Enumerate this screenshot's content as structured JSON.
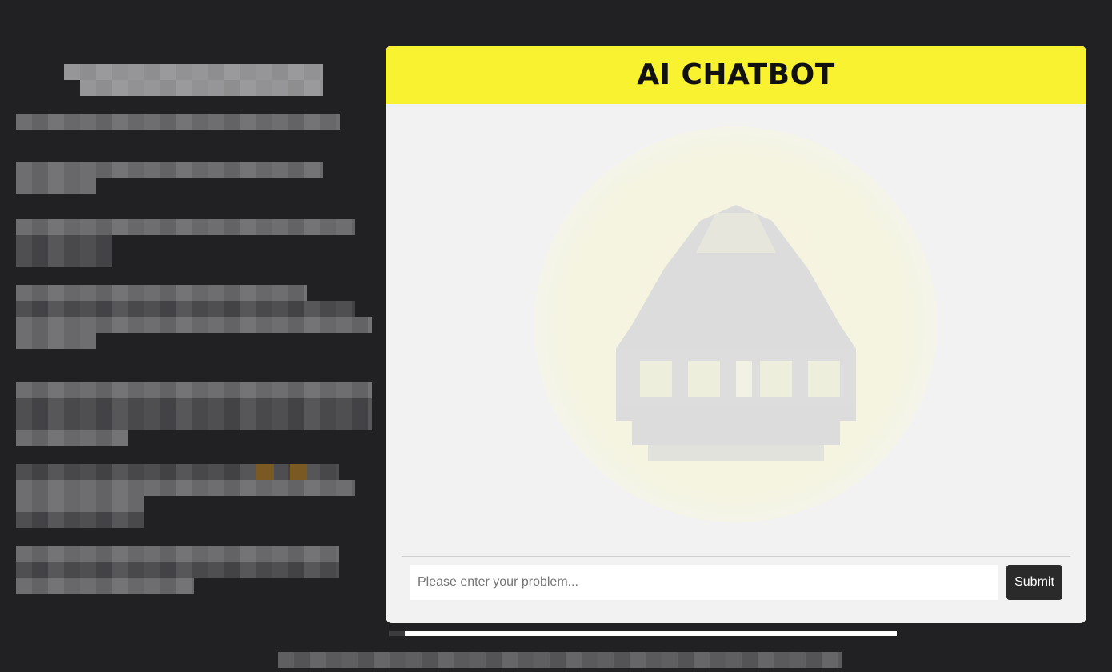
{
  "chat": {
    "title": "AI CHATBOT",
    "input_placeholder": "Please enter your problem...",
    "input_value": "",
    "submit_label": "Submit"
  },
  "logo": {
    "icon": "chatbot-logo-icon",
    "color": "#dcdcdc",
    "halo_color": "#f6f4e0"
  },
  "colors": {
    "page_background": "#212123",
    "header_background": "#f9f231",
    "card_background": "#f2f2f2",
    "button_background": "#2a2a2b"
  }
}
